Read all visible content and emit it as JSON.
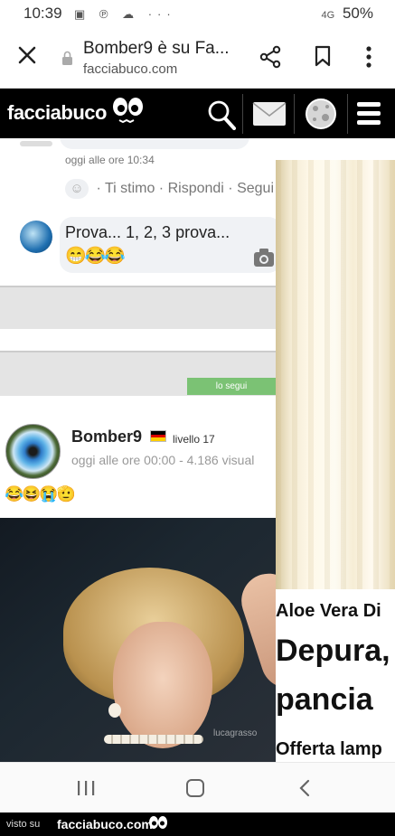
{
  "status_bar": {
    "time": "10:39",
    "left_icons": "▣ ℗ ☁ ···",
    "network": "4G",
    "battery": "50%"
  },
  "browser": {
    "tab_title": "Bomber9 è su Fa...",
    "url": "facciabuco.com",
    "icons": [
      "close-icon",
      "lock-icon",
      "share-icon",
      "bookmark-icon",
      "more-icon"
    ]
  },
  "site_header": {
    "logo": "facciabuco",
    "icons": [
      "search-icon",
      "mail-icon",
      "notifications-globe-icon",
      "menu-icon"
    ]
  },
  "comments": [
    {
      "time": "oggi alle ore 10:34",
      "action_like": "Ti stimo",
      "action_reply": "Rispondi",
      "action_follow": "Segui"
    },
    {
      "text": "Prova... 1, 2, 3 prova...",
      "emojis": "😁😂😂"
    }
  ],
  "follow_badge": "lo segui",
  "post": {
    "username": "Bomber9",
    "level": "livello 17",
    "meta": "oggi alle ore 00:00 - 4.186 visual",
    "emojis": "😂😆😭🫡",
    "watermark": "lucagrasso"
  },
  "ad": {
    "line1": "Aloe Vera Di",
    "line2": "Depura,",
    "line3": "pancia",
    "line4": "Offerta lamp"
  },
  "footer": {
    "visto_su": "visto su",
    "brand": "facciabuco.com"
  },
  "colors": {
    "header_bg": "#000000",
    "follow_green": "#7bc274",
    "bubble_bg": "#f0f2f5"
  }
}
